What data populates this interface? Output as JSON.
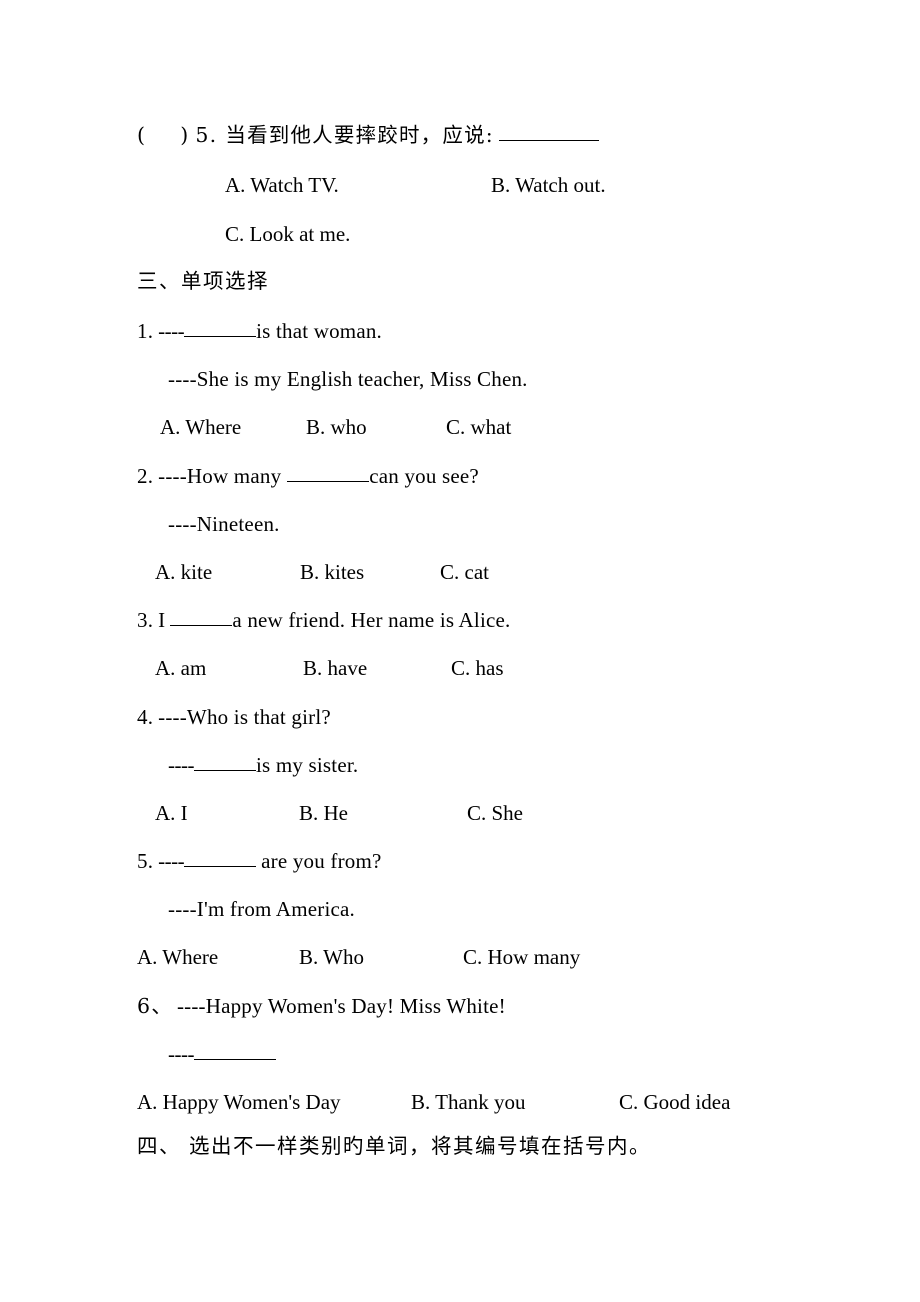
{
  "document": {
    "type": "english-worksheet-page",
    "background_color": "#ffffff",
    "text_color": "#000000"
  },
  "section_two_tail": {
    "question5": {
      "bracket_open": "(",
      "bracket_close": ")",
      "number": "5.",
      "prompt": "当看到他人要摔跤时，应说:",
      "options": [
        {
          "label": "A. Watch TV."
        },
        {
          "label": "B. Watch out."
        },
        {
          "label": "C. Look at me."
        }
      ]
    }
  },
  "section_three": {
    "heading": "三、单项选择",
    "questions": [
      {
        "number": "1.",
        "dashes": "----",
        "stem_after_blank": "is that woman.",
        "reply": "----She is my English teacher, Miss Chen.",
        "options": [
          {
            "label": "A. Where"
          },
          {
            "label": "B. who"
          },
          {
            "label": "C. what"
          }
        ]
      },
      {
        "number": "2.",
        "stem_before_blank": "----How many",
        "stem_after_blank": "can you see?",
        "reply": "----Nineteen.",
        "options": [
          {
            "label": "A. kite"
          },
          {
            "label": "B. kites"
          },
          {
            "label": "C. cat"
          }
        ]
      },
      {
        "number": "3.",
        "stem_before_blank": "I",
        "stem_after_blank": "a new friend. Her name is Alice.",
        "options": [
          {
            "label": "A. am"
          },
          {
            "label": "B. have"
          },
          {
            "label": "C. has"
          }
        ]
      },
      {
        "number": "4.",
        "stem": "----Who is that girl?",
        "reply_dashes": "----",
        "reply_after_blank": "is my sister.",
        "options": [
          {
            "label": "A. I"
          },
          {
            "label": "B. He"
          },
          {
            "label": "C. She"
          }
        ]
      },
      {
        "number": "5.",
        "dashes": "----",
        "stem_after_blank": "are you from?",
        "reply": "----I'm from America.",
        "options": [
          {
            "label": "A. Where"
          },
          {
            "label": "B. Who"
          },
          {
            "label": "C. How many"
          }
        ]
      },
      {
        "number": "6、",
        "stem": "----Happy Women's Day!   Miss White!",
        "reply_dashes": "----",
        "options": [
          {
            "label": "A. Happy Women's Day"
          },
          {
            "label": "B. Thank you"
          },
          {
            "label": "C. Good idea"
          }
        ]
      }
    ]
  },
  "section_four": {
    "heading": "四、 选出不一样类别旳单词，将其编号填在括号内。"
  }
}
